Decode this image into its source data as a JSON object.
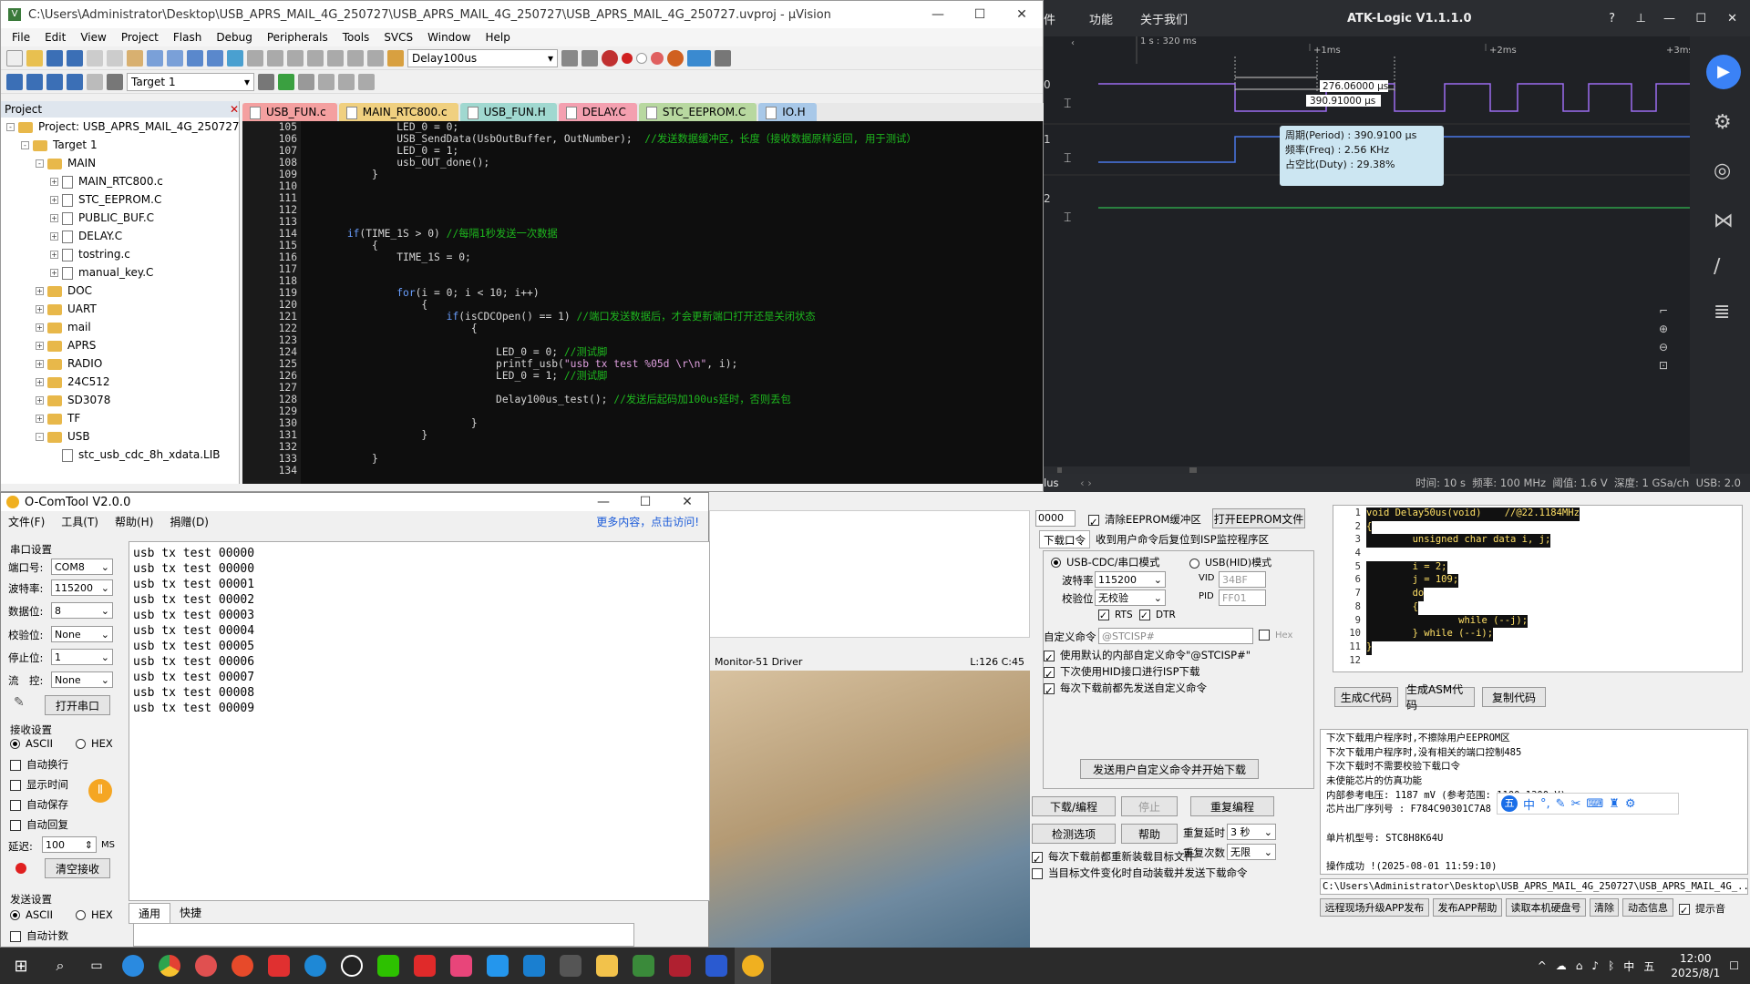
{
  "uvision": {
    "title": "C:\\Users\\Administrator\\Desktop\\USB_APRS_MAIL_4G_250727\\USB_APRS_MAIL_4G_250727\\USB_APRS_MAIL_4G_250727.uvproj - µVision",
    "menu": [
      "File",
      "Edit",
      "View",
      "Project",
      "Flash",
      "Debug",
      "Peripherals",
      "Tools",
      "SVCS",
      "Window",
      "Help"
    ],
    "toolbar_func": "Delay100us",
    "target": "Target 1",
    "project_header": "Project",
    "tree": [
      {
        "label": "Project: USB_APRS_MAIL_4G_250727",
        "indent": 0,
        "type": "proj",
        "pm": "-"
      },
      {
        "label": "Target 1",
        "indent": 1,
        "type": "folder",
        "pm": "-"
      },
      {
        "label": "MAIN",
        "indent": 2,
        "type": "folder",
        "pm": "-"
      },
      {
        "label": "MAIN_RTC800.c",
        "indent": 3,
        "type": "file",
        "pm": "+"
      },
      {
        "label": "STC_EEPROM.C",
        "indent": 3,
        "type": "file",
        "pm": "+"
      },
      {
        "label": "PUBLIC_BUF.C",
        "indent": 3,
        "type": "file",
        "pm": "+"
      },
      {
        "label": "DELAY.C",
        "indent": 3,
        "type": "file",
        "pm": "+"
      },
      {
        "label": "tostring.c",
        "indent": 3,
        "type": "file",
        "pm": "+"
      },
      {
        "label": "manual_key.C",
        "indent": 3,
        "type": "file",
        "pm": "+"
      },
      {
        "label": "DOC",
        "indent": 2,
        "type": "folder",
        "pm": "+"
      },
      {
        "label": "UART",
        "indent": 2,
        "type": "folder",
        "pm": "+"
      },
      {
        "label": "mail",
        "indent": 2,
        "type": "folder",
        "pm": "+"
      },
      {
        "label": "APRS",
        "indent": 2,
        "type": "folder",
        "pm": "+"
      },
      {
        "label": "RADIO",
        "indent": 2,
        "type": "folder",
        "pm": "+"
      },
      {
        "label": "24C512",
        "indent": 2,
        "type": "folder",
        "pm": "+"
      },
      {
        "label": "SD3078",
        "indent": 2,
        "type": "folder",
        "pm": "+"
      },
      {
        "label": "TF",
        "indent": 2,
        "type": "folder",
        "pm": "+"
      },
      {
        "label": "USB",
        "indent": 2,
        "type": "folder",
        "pm": "-"
      },
      {
        "label": "stc_usb_cdc_8h_xdata.LIB",
        "indent": 3,
        "type": "file",
        "pm": ""
      }
    ],
    "tabs": [
      {
        "label": "USB_FUN.c",
        "color": "#f4a0a0",
        "active": true
      },
      {
        "label": "MAIN_RTC800.c",
        "color": "#f0d080"
      },
      {
        "label": "USB_FUN.H",
        "color": "#a0d8d0"
      },
      {
        "label": "DELAY.C",
        "color": "#f4a0b0"
      },
      {
        "label": "STC_EEPROM.C",
        "color": "#b8d8a0"
      },
      {
        "label": "IO.H",
        "color": "#a8c8e8"
      }
    ],
    "lines": [
      "105",
      "106",
      "107",
      "108",
      "109",
      "110",
      "111",
      "112",
      "113",
      "114",
      "115",
      "116",
      "117",
      "118",
      "119",
      "120",
      "121",
      "122",
      "123",
      "124",
      "125",
      "126",
      "127",
      "128",
      "129",
      "130",
      "131",
      "132",
      "133",
      "134"
    ]
  },
  "atk": {
    "menu": [
      "件",
      "功能",
      "关于我们"
    ],
    "title": "ATK-Logic V1.1.1.0",
    "time_base": "1 s : 320 ms",
    "ticks": [
      "+1ms",
      "+2ms",
      "+3ms"
    ],
    "channels": [
      "0",
      "1",
      "2"
    ],
    "measure1": "276.06000 µs",
    "measure2": "390.91000 µs",
    "period_label": "周期(Period)",
    "period_value": ": 390.9100 µs",
    "freq_label": "频率(Freq)",
    "freq_value": ": 2.56 KHz",
    "duty_label": "占空比(Duty)",
    "duty_value": ": 29.38%",
    "status_plus": "lus",
    "status_bar": "时间: 10 s  频率: 100 MHz  阈值: 1.6 V  深度: 1 GSa/ch  USB: 2.0"
  },
  "comtool": {
    "title": "O-ComTool V2.0.0",
    "menu": [
      "文件(F)",
      "工具(T)",
      "帮助(H)",
      "捐赠(D)"
    ],
    "more": "更多内容，点击访问!",
    "serial_settings": "串口设置",
    "port_label": "端口号:",
    "port_value": "COM8",
    "baud_label": "波特率:",
    "baud_value": "115200",
    "data_label": "数据位:",
    "data_value": "8",
    "parity_label": "校验位:",
    "parity_value": "None",
    "stop_label": "停止位:",
    "stop_value": "1",
    "flow_label": "流　控:",
    "flow_value": "None",
    "open_port": "打开串口",
    "recv_settings": "接收设置",
    "ascii": "ASCII",
    "hex": "HEX",
    "auto_wrap": "自动换行",
    "show_time": "显示时间",
    "auto_save": "自动保存",
    "auto_reply": "自动回复",
    "delay_label": "延迟:",
    "delay_value": "100",
    "ms": "MS",
    "clear_recv": "清空接收",
    "send_settings": "发送设置",
    "auto_count": "自动计数",
    "tab_general": "通用",
    "tab_quick": "快捷",
    "received": [
      "usb tx test 00000",
      "usb tx test 00000",
      "usb tx test 00001",
      "usb tx test 00002",
      "usb tx test 00003",
      "usb tx test 00004",
      "usb tx test 00005",
      "usb tx test 00006",
      "usb tx test 00007",
      "usb tx test 00008",
      "usb tx test 00009"
    ]
  },
  "build": {
    "driver": "Monitor-51 Driver",
    "pos": "L:126 C:45"
  },
  "isp": {
    "addr_value": "0000",
    "clear_eeprom": "清除EEPROM缓冲区",
    "open_eeprom": "打开EEPROM文件",
    "tab_download": "下载口令",
    "tab_reset": "收到用户命令后复位到ISP监控程序区",
    "cdc_mode": "USB-CDC/串口模式",
    "hid_mode": "USB(HID)模式",
    "baud_label": "波特率",
    "baud_value": "115200",
    "parity_label": "校验位",
    "parity_value": "无校验",
    "rts": "RTS",
    "dtr": "DTR",
    "vid_label": "VID",
    "vid_value": "34BF",
    "pid_label": "PID",
    "pid_value": "FF01",
    "custom_cmd_label": "自定义命令",
    "custom_cmd_value": "@STCISP#",
    "hex_label": "Hex",
    "opt1": "使用默认的内部自定义命令\"@STCISP#\"",
    "opt2": "下次使用HID接口进行ISP下载",
    "opt3": "每次下载前都先发送自定义命令",
    "send_custom": "发送用户自定义命令并开始下载",
    "download": "下载/编程",
    "stop": "停止",
    "reprogram": "重复编程",
    "check": "检测选项",
    "help": "帮助",
    "repeat_delay_label": "重复延时",
    "repeat_delay_value": "3 秒",
    "repeat_count_label": "重复次数",
    "repeat_count_value": "无限",
    "reload1": "每次下载前都重新装载目标文件",
    "reload2": "当目标文件变化时自动装载并发送下载命令"
  },
  "isp2": {
    "code_lines": [
      "1",
      "2",
      "3",
      "4",
      "5",
      "6",
      "7",
      "8",
      "9",
      "10",
      "11",
      "12"
    ],
    "code": [
      "void Delay50us(void)\t//@22.1184MHz",
      "{",
      "\tunsigned char data i, j;",
      "",
      "\ti = 2;",
      "\tj = 109;",
      "\tdo",
      "\t{",
      "\t\twhile (--j);",
      "\t} while (--i);",
      "}",
      ""
    ],
    "gen_c": "生成C代码",
    "gen_asm": "生成ASM代码",
    "copy_code": "复制代码",
    "log": [
      "下次下载用户程序时,不擦除用户EEPROM区",
      "下次下载用户程序时,没有相关的端口控制485",
      "下次下载时不需要校验下载口令",
      "未使能芯片的仿真功能",
      "内部参考电压: 1187 mV (参考范围: 1100~1300mV)",
      "芯片出厂序列号 : F784C90301C7A8",
      "",
      "单片机型号: STC8H8K64U",
      "",
      "操作成功 !(2025-08-01 11:59:10)"
    ],
    "path": "C:\\Users\\Administrator\\Desktop\\USB_APRS_MAIL_4G_250727\\USB_APRS_MAIL_4G_...\\AP",
    "b1": "远程现场升级APP发布",
    "b2": "发布APP帮助",
    "b3": "读取本机硬盘号",
    "b4": "清除",
    "b5": "动态信息",
    "b6": "提示音"
  },
  "ime": {
    "mode": "中"
  },
  "taskbar": {
    "time": "12:00",
    "date": "2025/8/1",
    "lang": "中"
  }
}
